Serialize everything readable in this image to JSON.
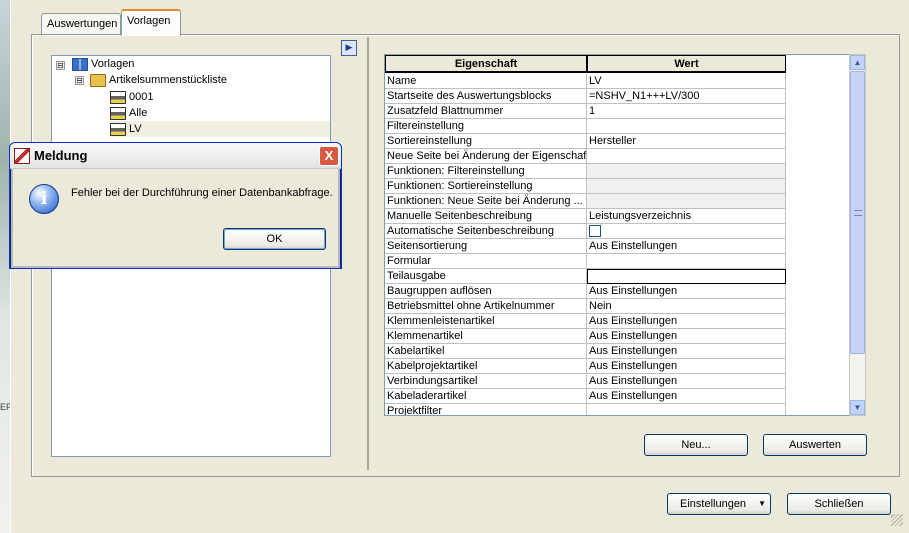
{
  "tabs": [
    {
      "label": "Auswertungen"
    },
    {
      "label": "Vorlagen"
    }
  ],
  "tree": {
    "root": "Vorlagen",
    "group": "Artikelsummenstückliste",
    "items": [
      "0001",
      "Alle",
      "LV"
    ],
    "expand_icons": [
      "⊟",
      "⊟"
    ]
  },
  "grid": {
    "headers": {
      "property": "Eigenschaft",
      "value": "Wert"
    },
    "rows": [
      {
        "property": "Name",
        "value": "LV"
      },
      {
        "property": "Startseite des Auswertungsblocks",
        "value": "=NSHV_N1+++LV/300"
      },
      {
        "property": "Zusatzfeld Blattnummer",
        "value": "1"
      },
      {
        "property": "Filtereinstellung",
        "value": ""
      },
      {
        "property": "Sortiereinstellung",
        "value": "Hersteller"
      },
      {
        "property": "Neue Seite bei Änderung der Eigenschaft",
        "value": ""
      },
      {
        "property": "Funktionen: Filtereinstellung",
        "value": ""
      },
      {
        "property": "Funktionen: Sortiereinstellung",
        "value": ""
      },
      {
        "property": "Funktionen: Neue Seite bei Änderung ...",
        "value": ""
      },
      {
        "property": "Manuelle Seitenbeschreibung",
        "value": "Leistungsverzeichnis"
      },
      {
        "property": "Automatische Seitenbeschreibung",
        "value": ""
      },
      {
        "property": "Seitensortierung",
        "value": "Aus Einstellungen"
      },
      {
        "property": "Formular",
        "value": ""
      },
      {
        "property": "Teilausgabe",
        "value": ""
      },
      {
        "property": "Baugruppen auflösen",
        "value": "Aus Einstellungen"
      },
      {
        "property": "Betriebsmittel ohne Artikelnummer",
        "value": "Nein"
      },
      {
        "property": "Klemmenleistenartikel",
        "value": "Aus Einstellungen"
      },
      {
        "property": "Klemmenartikel",
        "value": "Aus Einstellungen"
      },
      {
        "property": "Kabelartikel",
        "value": "Aus Einstellungen"
      },
      {
        "property": "Kabelprojektartikel",
        "value": "Aus Einstellungen"
      },
      {
        "property": "Verbindungsartikel",
        "value": "Aus Einstellungen"
      },
      {
        "property": "Kabeladerartikel",
        "value": "Aus Einstellungen"
      },
      {
        "property": "Projektfilter",
        "value": ""
      }
    ]
  },
  "buttons": {
    "neu": "Neu...",
    "auswerten": "Auswerten",
    "einstellungen": "Einstellungen",
    "schliessen": "Schließen",
    "ok": "OK"
  },
  "dialog": {
    "title": "Meldung",
    "message": "Fehler bei der Durchführung einer Datenbankabfrage.",
    "close_glyph": "X",
    "info_glyph": "i"
  },
  "scrollbar": {
    "up": "▲",
    "down": "▼"
  },
  "splitter_glyph": "▶",
  "dropdown_glyph": "▼",
  "background_text": "EPI"
}
